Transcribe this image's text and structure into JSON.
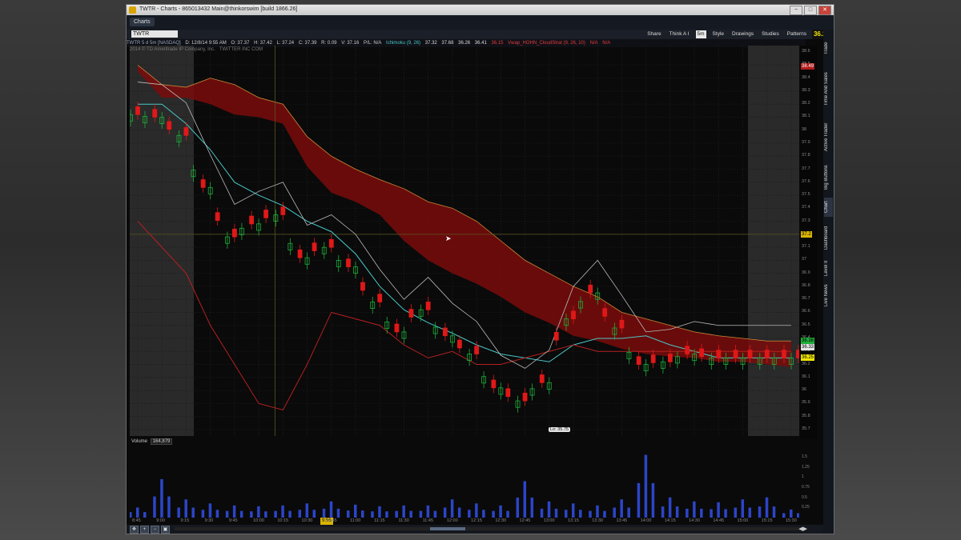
{
  "window": {
    "title": "TWTR - Charts - 865013432 Main@thinkorswim [build 1866.26]",
    "tab": "Charts",
    "controls": [
      "−",
      "□",
      "✕"
    ]
  },
  "toolbar": {
    "symbol": "TWTR",
    "items": [
      "Share",
      "Think A I",
      "5m",
      "Style",
      "Drawings",
      "Studies",
      "Patterns"
    ],
    "last_price": "36.29"
  },
  "infobar": {
    "symbol_desc": "TWTR 5 d 5m [NASDAQ]",
    "date": "D: 12/8/14 9:55 AM",
    "open": "O: 37.37",
    "high": "H: 37.42",
    "low": "L: 37.24",
    "close": "C: 37.39",
    "range": "R: 0.09",
    "volume": "V: 37.16",
    "pl": "P/L: N/A",
    "ichimoku_label": "Ichimoku (9, 26)",
    "ichimoku_values": [
      "37.32",
      "37.68",
      "36.26",
      "36.41"
    ],
    "vwap_values": [
      "36.15",
      "Vwap_HOHN_CloudStrat (9, 26, 10)",
      "N/A",
      "N/A"
    ]
  },
  "chart_meta": {
    "company": "TWITTER INC COM",
    "copyright": "2014 © TD Ameritrade IP Company, Inc."
  },
  "annotations": {
    "low_label": "Lo: 35.75",
    "cursor_price": "37.2"
  },
  "axis_badges": {
    "top_cloud": "38.49",
    "green": "36.38",
    "white": "36.33",
    "yellow": "36.25"
  },
  "volume_panel": {
    "label": "Volume",
    "value": "164,879"
  },
  "time_cursor": "9:55",
  "chart_data": {
    "type": "line",
    "title": "",
    "x": [
      "8:45",
      "9:00",
      "9:15",
      "9:30",
      "9:45",
      "10:00",
      "10:15",
      "10:30",
      "10:45",
      "11:00",
      "11:15",
      "11:30",
      "11:45",
      "12:00",
      "12:15",
      "12:30",
      "12:45",
      "13:00",
      "13:15",
      "13:30",
      "13:45",
      "14:00",
      "14:15",
      "14:30",
      "14:45",
      "15:00",
      "15:15",
      "15:30"
    ],
    "price_ticks": [
      "38.6",
      "38.5",
      "38.4",
      "38.3",
      "38.2",
      "38.1",
      "38",
      "37.9",
      "37.8",
      "37.7",
      "37.6",
      "37.5",
      "37.4",
      "37.3",
      "37.2",
      "37.1",
      "37",
      "36.9",
      "36.8",
      "36.7",
      "36.6",
      "36.5",
      "36.4",
      "36.3",
      "36.2",
      "36.1",
      "36",
      "35.9",
      "35.8",
      "35.7"
    ],
    "ylim": [
      35.65,
      38.65
    ],
    "volume_ticks": [
      "1.5",
      "1.25",
      "1",
      "0.75",
      "0.5",
      "0.25"
    ],
    "volume_unit": "millions",
    "price_series": [
      {
        "name": "candles_close",
        "values": [
          38.12,
          38.1,
          37.96,
          37.56,
          37.18,
          37.28,
          37.35,
          37.02,
          37.1,
          36.95,
          36.68,
          36.45,
          36.62,
          36.42,
          36.28,
          36.02,
          35.92,
          36.06,
          36.55,
          36.75,
          36.48,
          36.2,
          36.22,
          36.28,
          36.25,
          36.25,
          36.25,
          36.25
        ]
      },
      {
        "name": "kijun",
        "values": [
          38.2,
          38.2,
          38.05,
          37.85,
          37.6,
          37.5,
          37.42,
          37.3,
          37.22,
          37.05,
          36.8,
          36.62,
          36.52,
          36.44,
          36.35,
          36.28,
          36.25,
          36.22,
          36.35,
          36.4,
          36.4,
          36.42,
          36.35,
          36.3,
          36.25,
          36.25,
          36.25,
          36.25
        ]
      },
      {
        "name": "lagging",
        "values": [
          37.3,
          37.1,
          36.9,
          36.5,
          36.2,
          35.9,
          35.85,
          36.2,
          36.6,
          36.55,
          36.5,
          36.35,
          36.25,
          36.3,
          36.2,
          36.2,
          36.25,
          36.3,
          36.35,
          36.3,
          36.3,
          36.3,
          36.3,
          36.3,
          36.3,
          36.3,
          36.3,
          36.3
        ]
      }
    ],
    "cloud_upper": [
      38.5,
      38.35,
      38.33,
      38.4,
      38.35,
      38.25,
      38.2,
      37.95,
      37.8,
      37.7,
      37.62,
      37.55,
      37.45,
      37.4,
      37.3,
      37.15,
      37.0,
      36.9,
      36.8,
      36.72,
      36.6,
      36.55,
      36.5,
      36.45,
      36.42,
      36.4,
      36.38,
      36.38
    ],
    "cloud_lower": [
      38.45,
      38.25,
      38.25,
      38.2,
      38.12,
      38.1,
      38.05,
      37.72,
      37.52,
      37.45,
      37.35,
      37.15,
      37.0,
      36.9,
      36.82,
      36.72,
      36.6,
      36.52,
      36.42,
      36.38,
      36.32,
      36.28,
      36.26,
      36.25,
      36.22,
      36.22,
      36.2,
      36.18
    ],
    "volume": [
      0.25,
      0.95,
      0.45,
      0.35,
      0.3,
      0.28,
      0.3,
      0.35,
      0.4,
      0.32,
      0.28,
      0.3,
      0.3,
      0.45,
      0.35,
      0.3,
      0.9,
      0.4,
      0.35,
      0.3,
      0.45,
      1.55,
      0.5,
      0.4,
      0.38,
      0.45,
      0.5,
      0.2
    ]
  }
}
